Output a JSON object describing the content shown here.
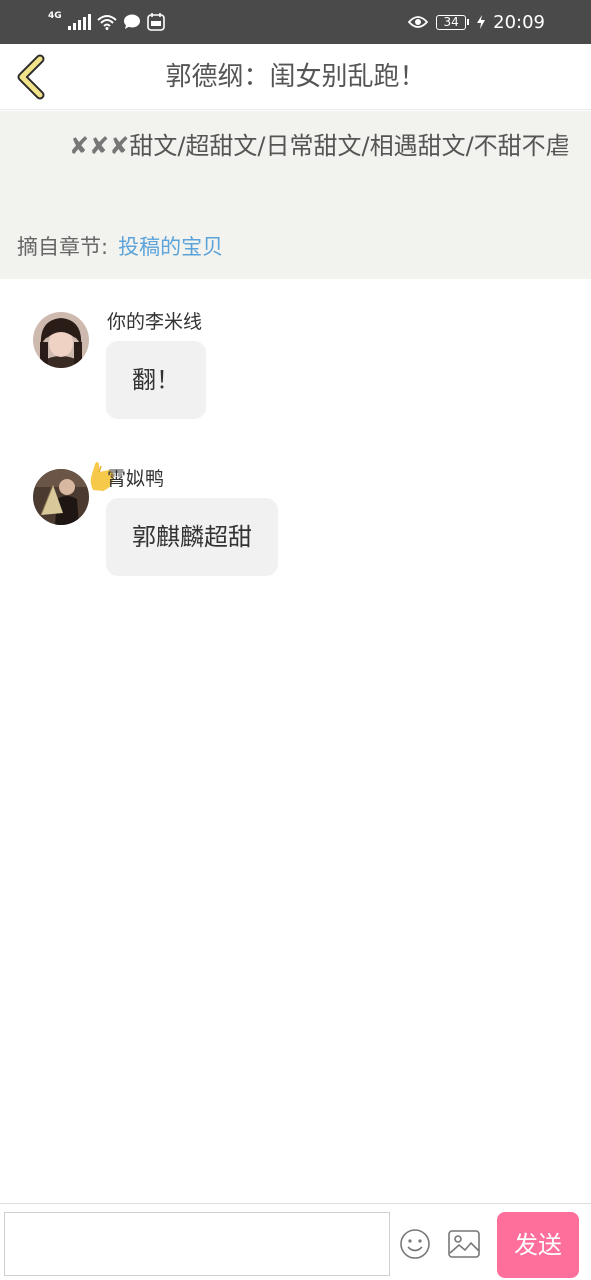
{
  "status_bar": {
    "network": "4G",
    "battery": "34",
    "time": "20:09"
  },
  "header": {
    "title": "郭德纲：闺女别乱跑！"
  },
  "excerpt": {
    "marks": "✘✘✘",
    "text": "甜文/超甜文/日常甜文/相遇甜文/不甜不虐",
    "chapter_label": "摘自章节:",
    "chapter_link": "投稿的宝贝"
  },
  "messages": [
    {
      "author": "你的李米线",
      "text": "翻！"
    },
    {
      "author": "霄姒鸭",
      "text": "郭麒麟超甜"
    }
  ],
  "input": {
    "placeholder": "",
    "value": ""
  },
  "send_button": {
    "label": "发送"
  },
  "colors": {
    "status_bar": "#4a4a4a",
    "excerpt_bg": "#f2f3ef",
    "link": "#5ba3d9",
    "bubble": "#f1f1f1",
    "send": "#ff6f9c",
    "back_arrow": "#f2e38a"
  }
}
